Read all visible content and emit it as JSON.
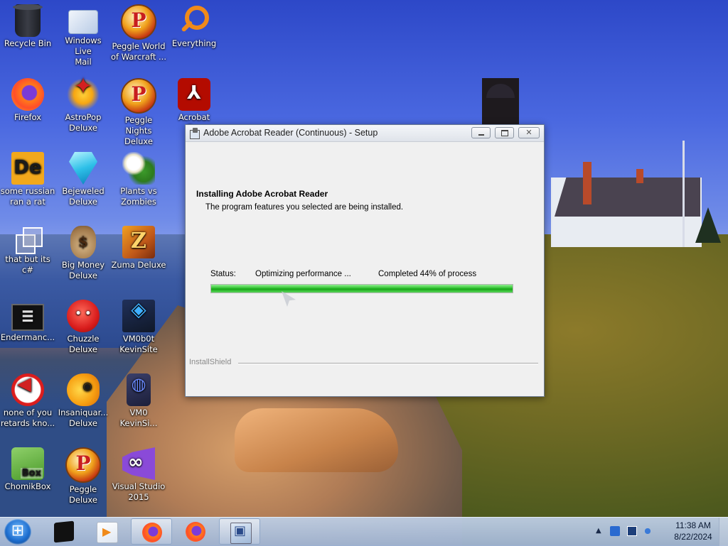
{
  "desktop": {
    "icons": [
      {
        "label": "Recycle Bin",
        "icon": "recycle-bin-icon"
      },
      {
        "label": "Windows Live\nMail",
        "icon": "windows-live-mail-icon"
      },
      {
        "label": "Peggle World\nof Warcraft ...",
        "icon": "peggle-icon"
      },
      {
        "label": "Everything",
        "icon": "everything-search-icon"
      },
      {
        "label": "Firefox",
        "icon": "firefox-icon"
      },
      {
        "label": "AstroPop\nDeluxe",
        "icon": "astropop-icon"
      },
      {
        "label": "Peggle Nights\nDeluxe",
        "icon": "peggle-nights-icon"
      },
      {
        "label": "Acrobat\nR...",
        "icon": "acrobat-icon"
      },
      {
        "label": "some russian\nran a rat",
        "icon": "de-icon"
      },
      {
        "label": "Bejeweled\nDeluxe",
        "icon": "bejeweled-gem-icon"
      },
      {
        "label": "Plants vs\nZombies",
        "icon": "plants-vs-zombies-icon"
      },
      {
        "label": "that but its c#",
        "icon": "windows-stack-icon"
      },
      {
        "label": "Big Money\nDeluxe",
        "icon": "money-bag-icon"
      },
      {
        "label": "Zuma Deluxe",
        "icon": "zuma-icon"
      },
      {
        "label": "Endermanc...",
        "icon": "terminal-icon"
      },
      {
        "label": "Chuzzle\nDeluxe",
        "icon": "chuzzle-icon"
      },
      {
        "label": "VM0b0t\nKevinSite",
        "icon": "vm-icon"
      },
      {
        "label": "none of you\nretards kno...",
        "icon": "red-circle-icon"
      },
      {
        "label": "Insaniquar...\nDeluxe",
        "icon": "fish-icon"
      },
      {
        "label": "VM0\nKevinSi...",
        "icon": "vm-phone-icon"
      },
      {
        "label": "ChomikBox",
        "icon": "chomikbox-icon"
      },
      {
        "label": "Peggle Deluxe",
        "icon": "peggle-deluxe-icon"
      },
      {
        "label": "Visual Studio\n2015",
        "icon": "visual-studio-icon"
      }
    ]
  },
  "window": {
    "title": "Adobe Acrobat Reader (Continuous) - Setup",
    "heading": "Installing Adobe Acrobat Reader",
    "subheading": "The program features you selected are being installed.",
    "status_label": "Status:",
    "status_value": "Optimizing performance ...",
    "progress_text": "Completed 44% of process",
    "progress_percent": 100,
    "brand": "InstallShield"
  },
  "taskbar": {
    "items": [
      {
        "name": "vm-taskbar-item",
        "icon": "vm-icon"
      },
      {
        "name": "media-taskbar-item",
        "icon": "media-player-icon"
      },
      {
        "name": "firefox-taskbar-item-active",
        "icon": "firefox-icon"
      },
      {
        "name": "firefox-taskbar-item",
        "icon": "firefox-icon"
      },
      {
        "name": "setup-taskbar-item",
        "icon": "installer-icon"
      }
    ],
    "clock_time": "11:38 AM",
    "clock_date": "8/22/2024"
  },
  "colors": {
    "progress_green": "#2bbf2b",
    "taskbar": "#b6c8e2",
    "acrobat_red": "#b30b00"
  }
}
